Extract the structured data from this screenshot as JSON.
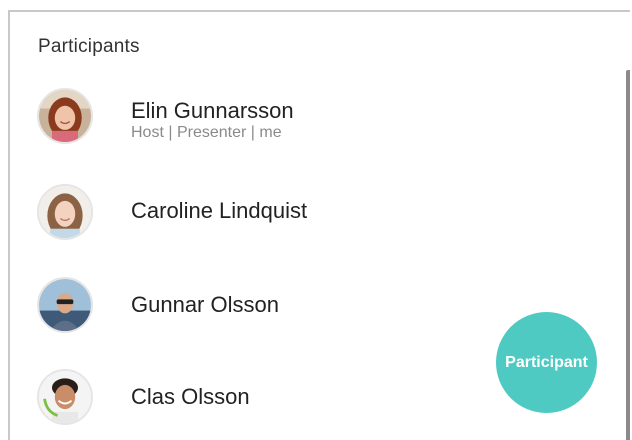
{
  "panel": {
    "title": "Participants"
  },
  "participants": [
    {
      "name": "Elin Gunnarsson",
      "roles": "Host | Presenter | me"
    },
    {
      "name": "Caroline Lindquist",
      "roles": ""
    },
    {
      "name": "Gunnar Olsson",
      "roles": ""
    },
    {
      "name": "Clas Olsson",
      "roles": ""
    }
  ],
  "fab": {
    "label": "Participant",
    "color": "#4ecac2"
  },
  "colors": {
    "title": "#333333",
    "name": "#222222",
    "roles": "#8a8a8a",
    "border": "#c8c8c8"
  },
  "icons": {
    "avatars": [
      "avatar-elin",
      "avatar-caroline",
      "avatar-gunnar",
      "avatar-clas"
    ]
  }
}
